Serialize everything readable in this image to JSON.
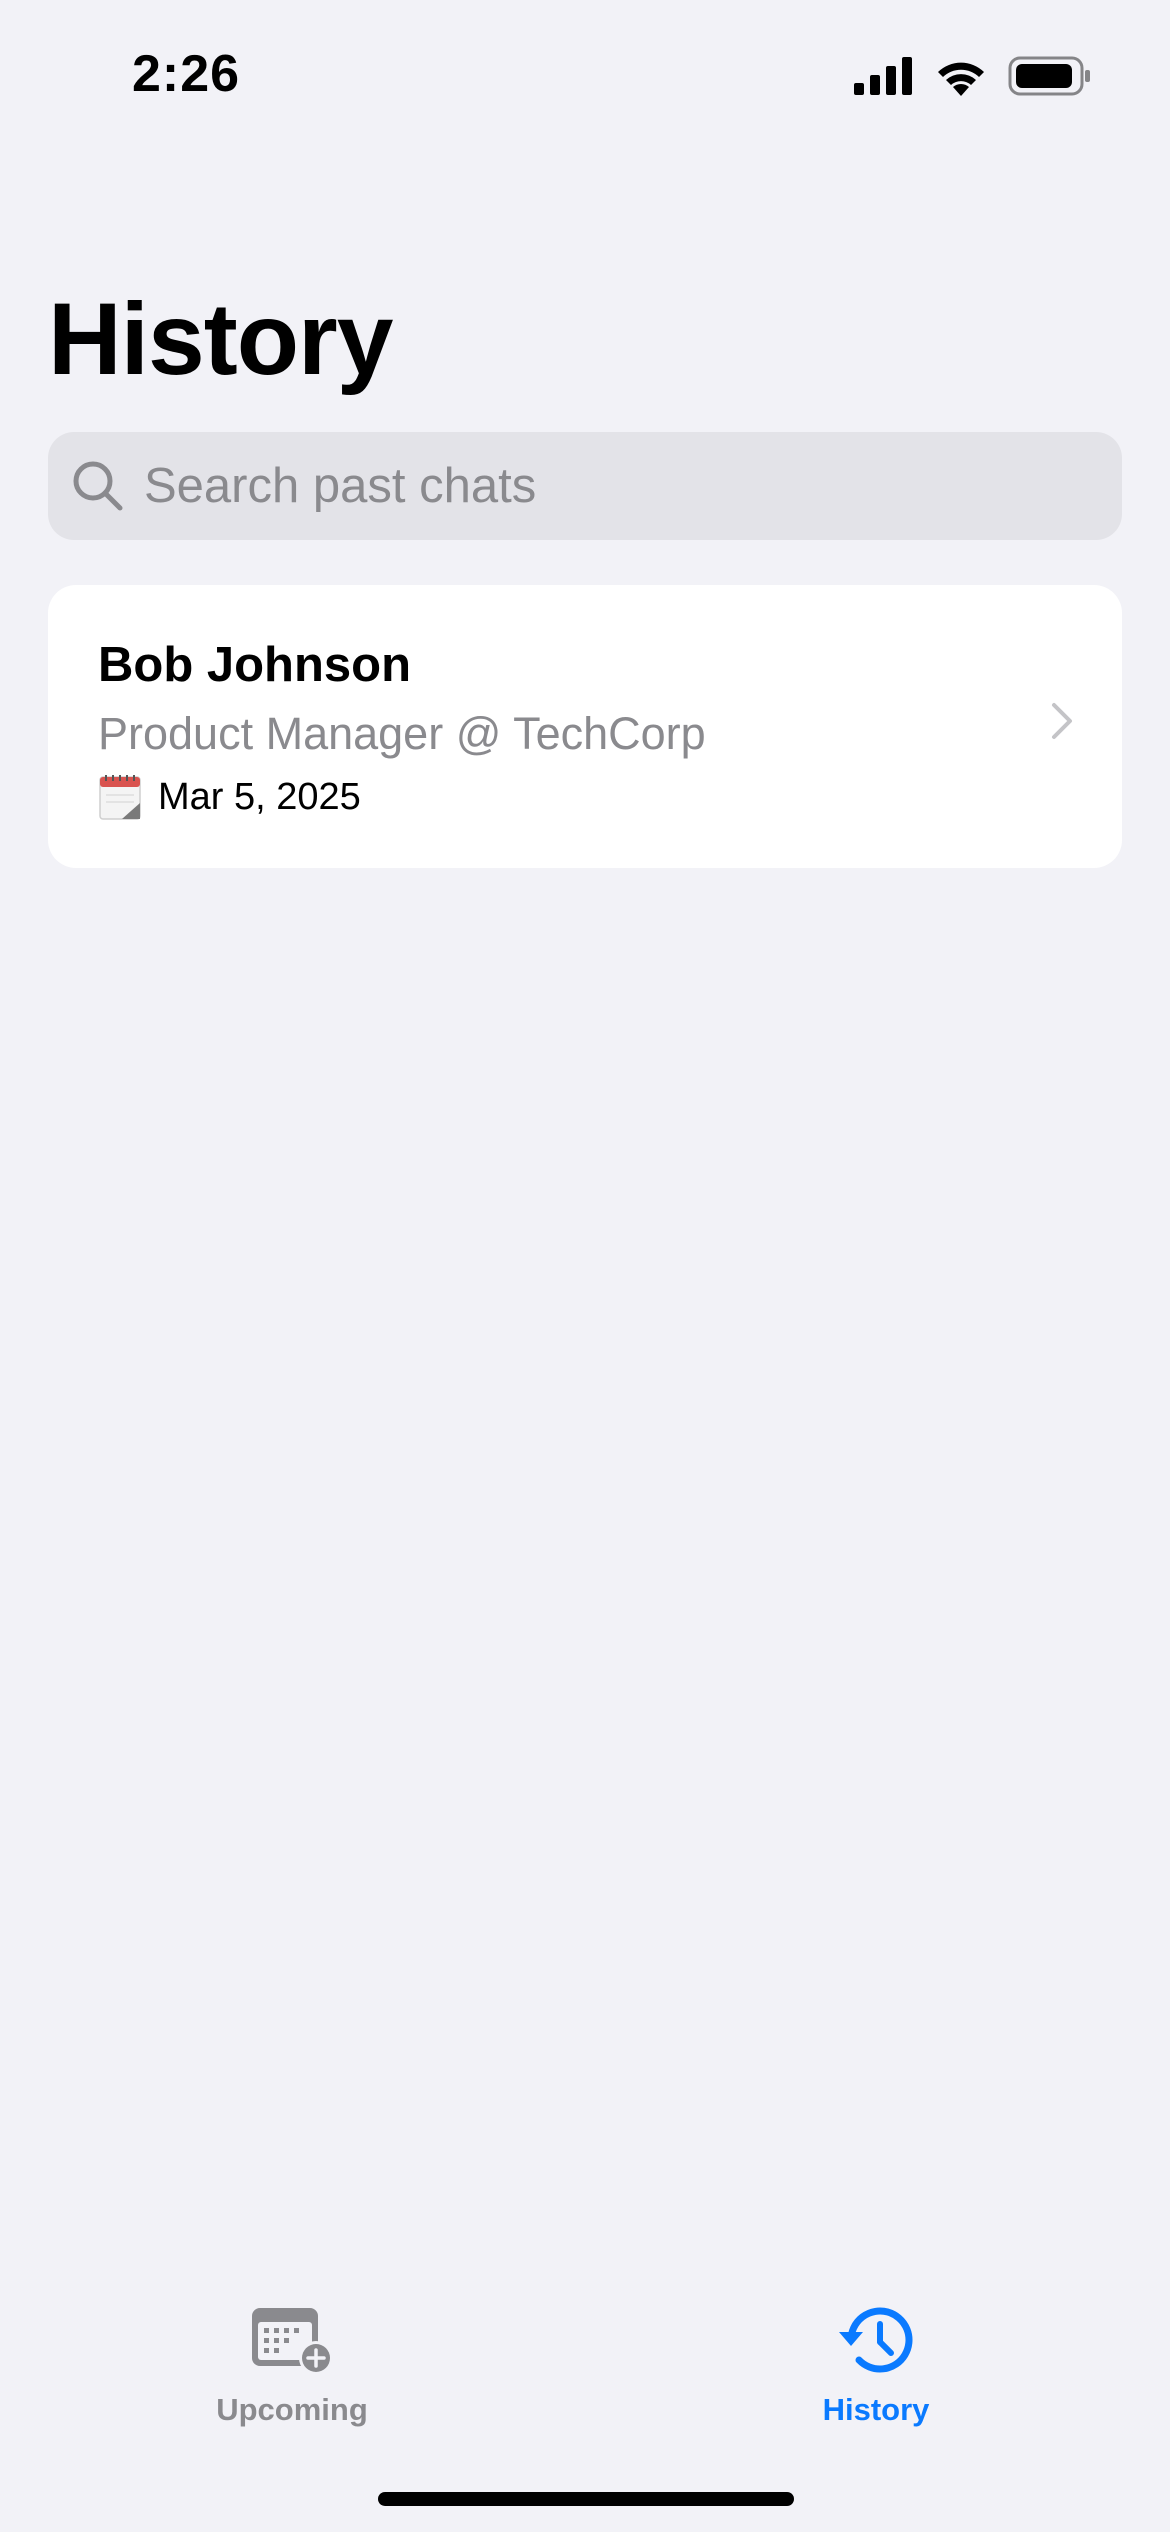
{
  "status_bar": {
    "time": "2:26"
  },
  "page": {
    "title": "History"
  },
  "search": {
    "placeholder": "Search past chats",
    "value": ""
  },
  "history": {
    "items": [
      {
        "name": "Bob Johnson",
        "role": "Product Manager @ TechCorp",
        "date": "Mar 5, 2025"
      }
    ]
  },
  "tabs": [
    {
      "label": "Upcoming",
      "icon": "calendar-add-icon",
      "active": false
    },
    {
      "label": "History",
      "icon": "history-clock-icon",
      "active": true
    }
  ],
  "colors": {
    "accent": "#0a7aff",
    "background": "#f2f2f7",
    "secondary_text": "#8a8a8e"
  }
}
